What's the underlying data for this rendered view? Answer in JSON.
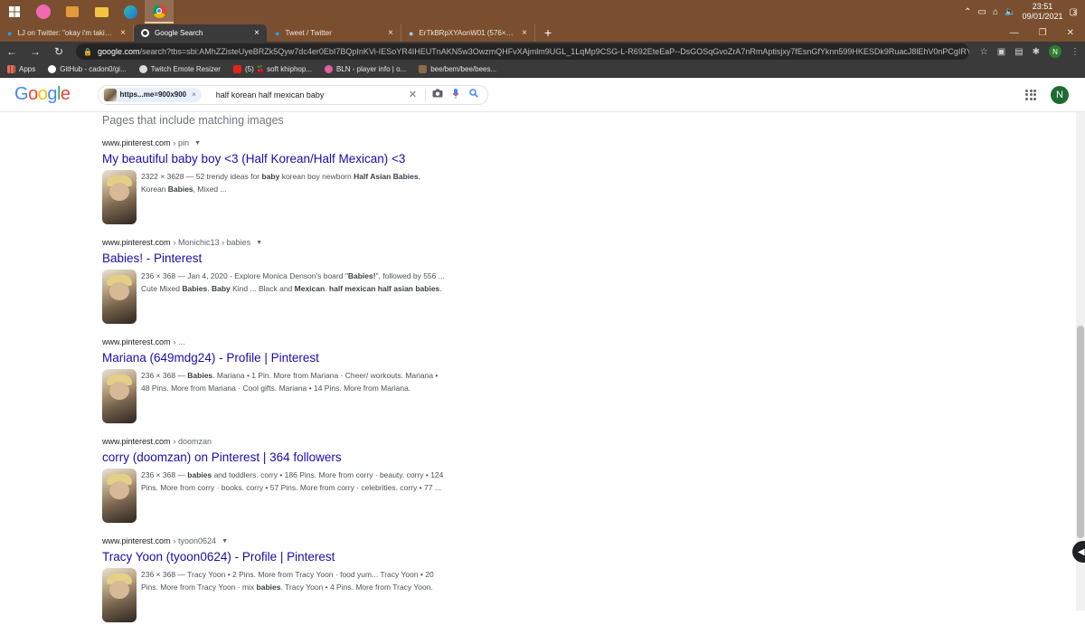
{
  "taskbar": {
    "clock_time": "23:51",
    "clock_date": "09/01/2021",
    "notification_count": "3"
  },
  "tabs": [
    {
      "title": "LJ on Twitter: \"okay i'm taking a",
      "icon": "twitter-icon"
    },
    {
      "title": "Google Search",
      "icon": "google-icon"
    },
    {
      "title": "Tweet / Twitter",
      "icon": "twitter-icon"
    },
    {
      "title": "ErTkBRpXYAonW01 (576×900)",
      "icon": "image-icon"
    }
  ],
  "address": {
    "domain": "google.com",
    "path": "/search?tbs=sbi:AMhZZisteUyeBRZk5Qyw7dc4er0EbI7BQpInKVi-IESoYR4IHEUTnAKN5w3OwzmQHFvXAjmlm9UGL_1LqMp9CSG-L-R692EteEaP--DsGOSqGvoZrA7nRmAptisjxy7fEsnGfYknn599HKESDk9RuacJ8lEhV0nPCgIRYk6MKYoG2Hfjvn6xzi..."
  },
  "bookmarks": [
    {
      "label": "Apps",
      "icon": "apps-grid-icon"
    },
    {
      "label": "GitHub - cadon0/gi...",
      "icon": "github-icon"
    },
    {
      "label": "Twitch Emote Resizer",
      "icon": "globe-icon"
    },
    {
      "label": "(5) 🍒 soft khiphop...",
      "icon": "youtube-icon"
    },
    {
      "label": "BLN - player info | o...",
      "icon": "bln-icon"
    },
    {
      "label": "bee/bem/bee/bees...",
      "icon": "bee-icon"
    }
  ],
  "search": {
    "logo": "Google",
    "chip_label": "https...me=900x900",
    "query": "half korean half mexican baby",
    "user_initial": "N"
  },
  "section_title": "Pages that include matching images",
  "results": [
    {
      "site": "www.pinterest.com",
      "path": "› pin",
      "title": "My beautiful baby boy <3 (Half Korean/Half Mexican) <3",
      "snippet_html": "2322 × 3628 — 52 trendy ideas for <b>baby</b> korean boy newborn <b>Half Asian Babies</b>, Korean <b>Babies</b>, Mixed ..."
    },
    {
      "site": "www.pinterest.com",
      "path": "› Monichic13 › babies",
      "title": "Babies! - Pinterest",
      "snippet_html": "236 × 368 — Jan 4, 2020 - Explore Monica Denson's board \"<b>Babies!</b>\", followed by 556 ... Cute Mixed <b>Babies</b>. <b>Baby</b> Kind ... Black and <b>Mexican</b>. <b>half mexican half asian babies</b>."
    },
    {
      "site": "www.pinterest.com",
      "path": "› ...",
      "title": "Mariana (649mdg24) - Profile | Pinterest",
      "snippet_html": "236 × 368 — <b>Babies</b>. Mariana • 1 Pin. More from Mariana · Cheer/ workouts. Mariana • 48 Pins. More from Mariana · Cool gifts. Mariana • 14 Pins. More from Mariana."
    },
    {
      "site": "www.pinterest.com",
      "path": "› doomzan",
      "title": "corry (doomzan) on Pinterest | 364 followers",
      "snippet_html": "236 × 368 — <b>babies</b> and toddlers. corry • 186 Pins. More from corry · beauty. corry • 124 Pins. More from corry · books. corry • 57 Pins. More from corry · celebrities. corry • 77 ..."
    },
    {
      "site": "www.pinterest.com",
      "path": "› tyoon0624",
      "title": "Tracy Yoon (tyoon0624) - Profile | Pinterest",
      "snippet_html": "236 × 368 — Tracy Yoon • 2 Pins. More from Tracy Yoon · food yum... Tracy Yoon • 20 Pins. More from Tracy Yoon · mix <b>babies</b>. Tracy Yoon • 4 Pins. More from Tracy Yoon."
    }
  ],
  "colors": {
    "taskbar_bg": "#7a4f2f",
    "toolbar_bg": "#3a3a3a",
    "link": "#1a0dab",
    "user_avatar": "#1e6b32"
  }
}
